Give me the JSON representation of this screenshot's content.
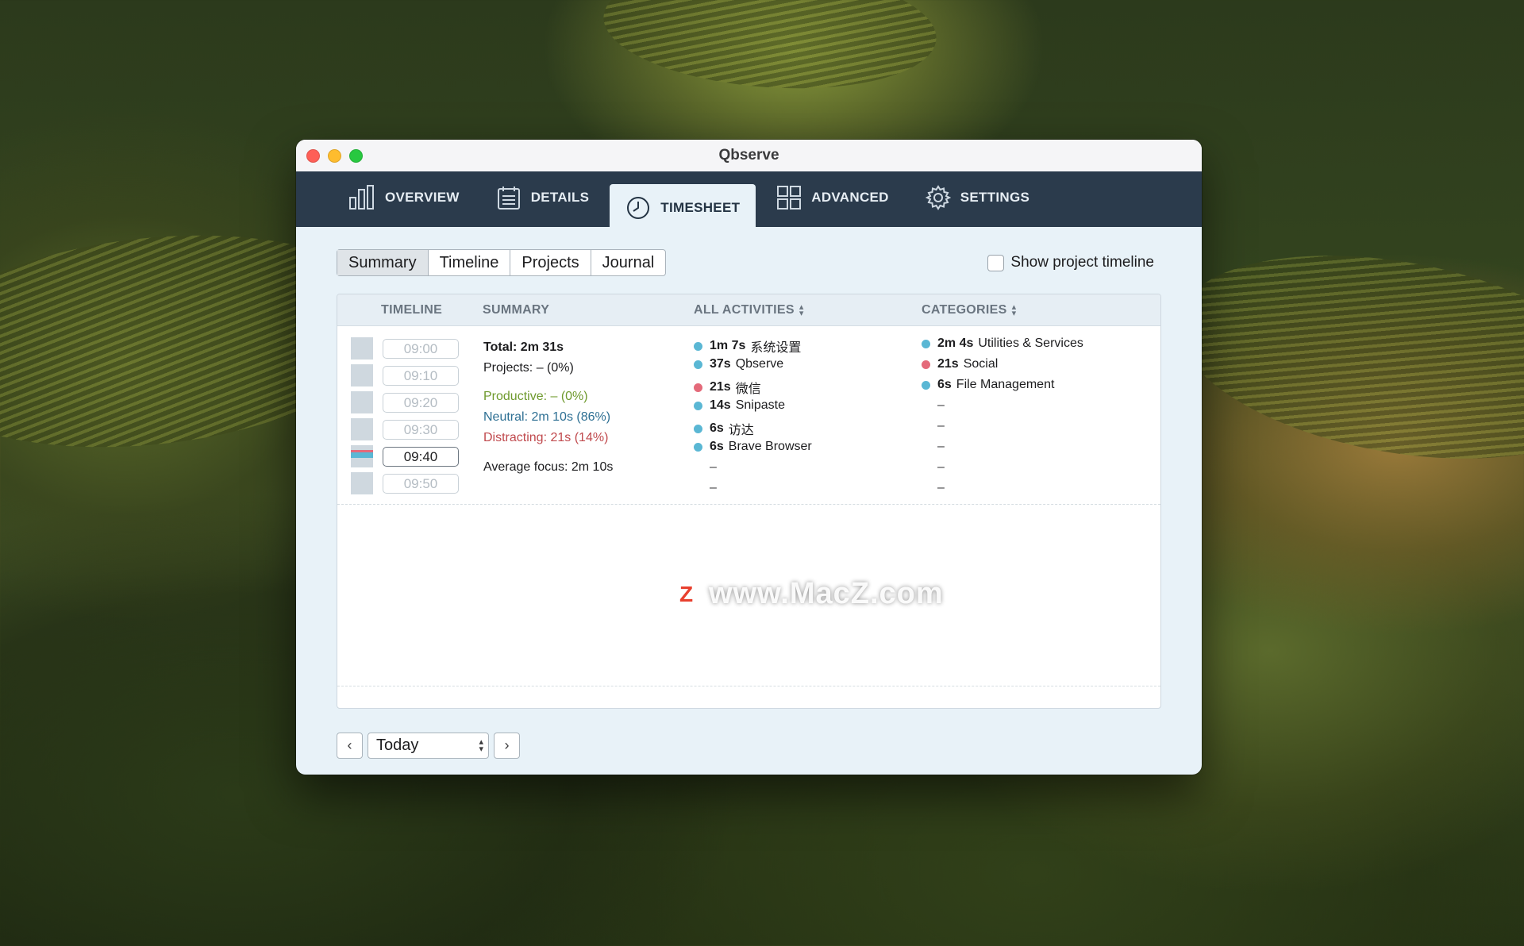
{
  "window": {
    "title": "Qbserve"
  },
  "nav": {
    "tabs": [
      {
        "label": "OVERVIEW",
        "icon": "bar-chart-icon"
      },
      {
        "label": "DETAILS",
        "icon": "document-list-icon"
      },
      {
        "label": "TIMESHEET",
        "icon": "clock-icon",
        "active": true
      },
      {
        "label": "ADVANCED",
        "icon": "grid-icon"
      },
      {
        "label": "SETTINGS",
        "icon": "gear-icon"
      }
    ]
  },
  "views": {
    "tabs": [
      "Summary",
      "Timeline",
      "Projects",
      "Journal"
    ],
    "selected": "Summary"
  },
  "project_timeline": {
    "label": "Show project timeline",
    "checked": false
  },
  "table": {
    "headers": {
      "timeline": "TIMELINE",
      "summary": "SUMMARY",
      "activities": "ALL ACTIVITIES",
      "categories": "CATEGORIES"
    },
    "times": [
      "09:00",
      "09:10",
      "09:20",
      "09:30",
      "09:40",
      "09:50"
    ],
    "active_time": "09:40",
    "summary": {
      "total": "Total: 2m 31s",
      "projects": "Projects: – (0%)",
      "productive": "Productive: – (0%)",
      "neutral": "Neutral: 2m 10s (86%)",
      "distracting": "Distracting: 21s (14%)",
      "focus": "Average focus: 2m 10s"
    },
    "activities": [
      {
        "duration": "1m 7s",
        "name": "系统设置",
        "color": "#5ab7d4"
      },
      {
        "duration": "37s",
        "name": "Qbserve",
        "color": "#5ab7d4"
      },
      {
        "duration": "21s",
        "name": "微信",
        "color": "#e46a7a"
      },
      {
        "duration": "14s",
        "name": "Snipaste",
        "color": "#5ab7d4"
      },
      {
        "duration": "6s",
        "name": "访达",
        "color": "#5ab7d4"
      },
      {
        "duration": "6s",
        "name": "Brave Browser",
        "color": "#5ab7d4"
      }
    ],
    "categories": [
      {
        "duration": "2m 4s",
        "name": "Utilities & Services",
        "color": "#5ab7d4"
      },
      {
        "duration": "21s",
        "name": "Social",
        "color": "#e46a7a"
      },
      {
        "duration": "6s",
        "name": "File Management",
        "color": "#5ab7d4"
      }
    ],
    "empty_marker": "–"
  },
  "watermark": {
    "badge": "Z",
    "text": "www.MacZ.com"
  },
  "datebar": {
    "selected": "Today"
  }
}
